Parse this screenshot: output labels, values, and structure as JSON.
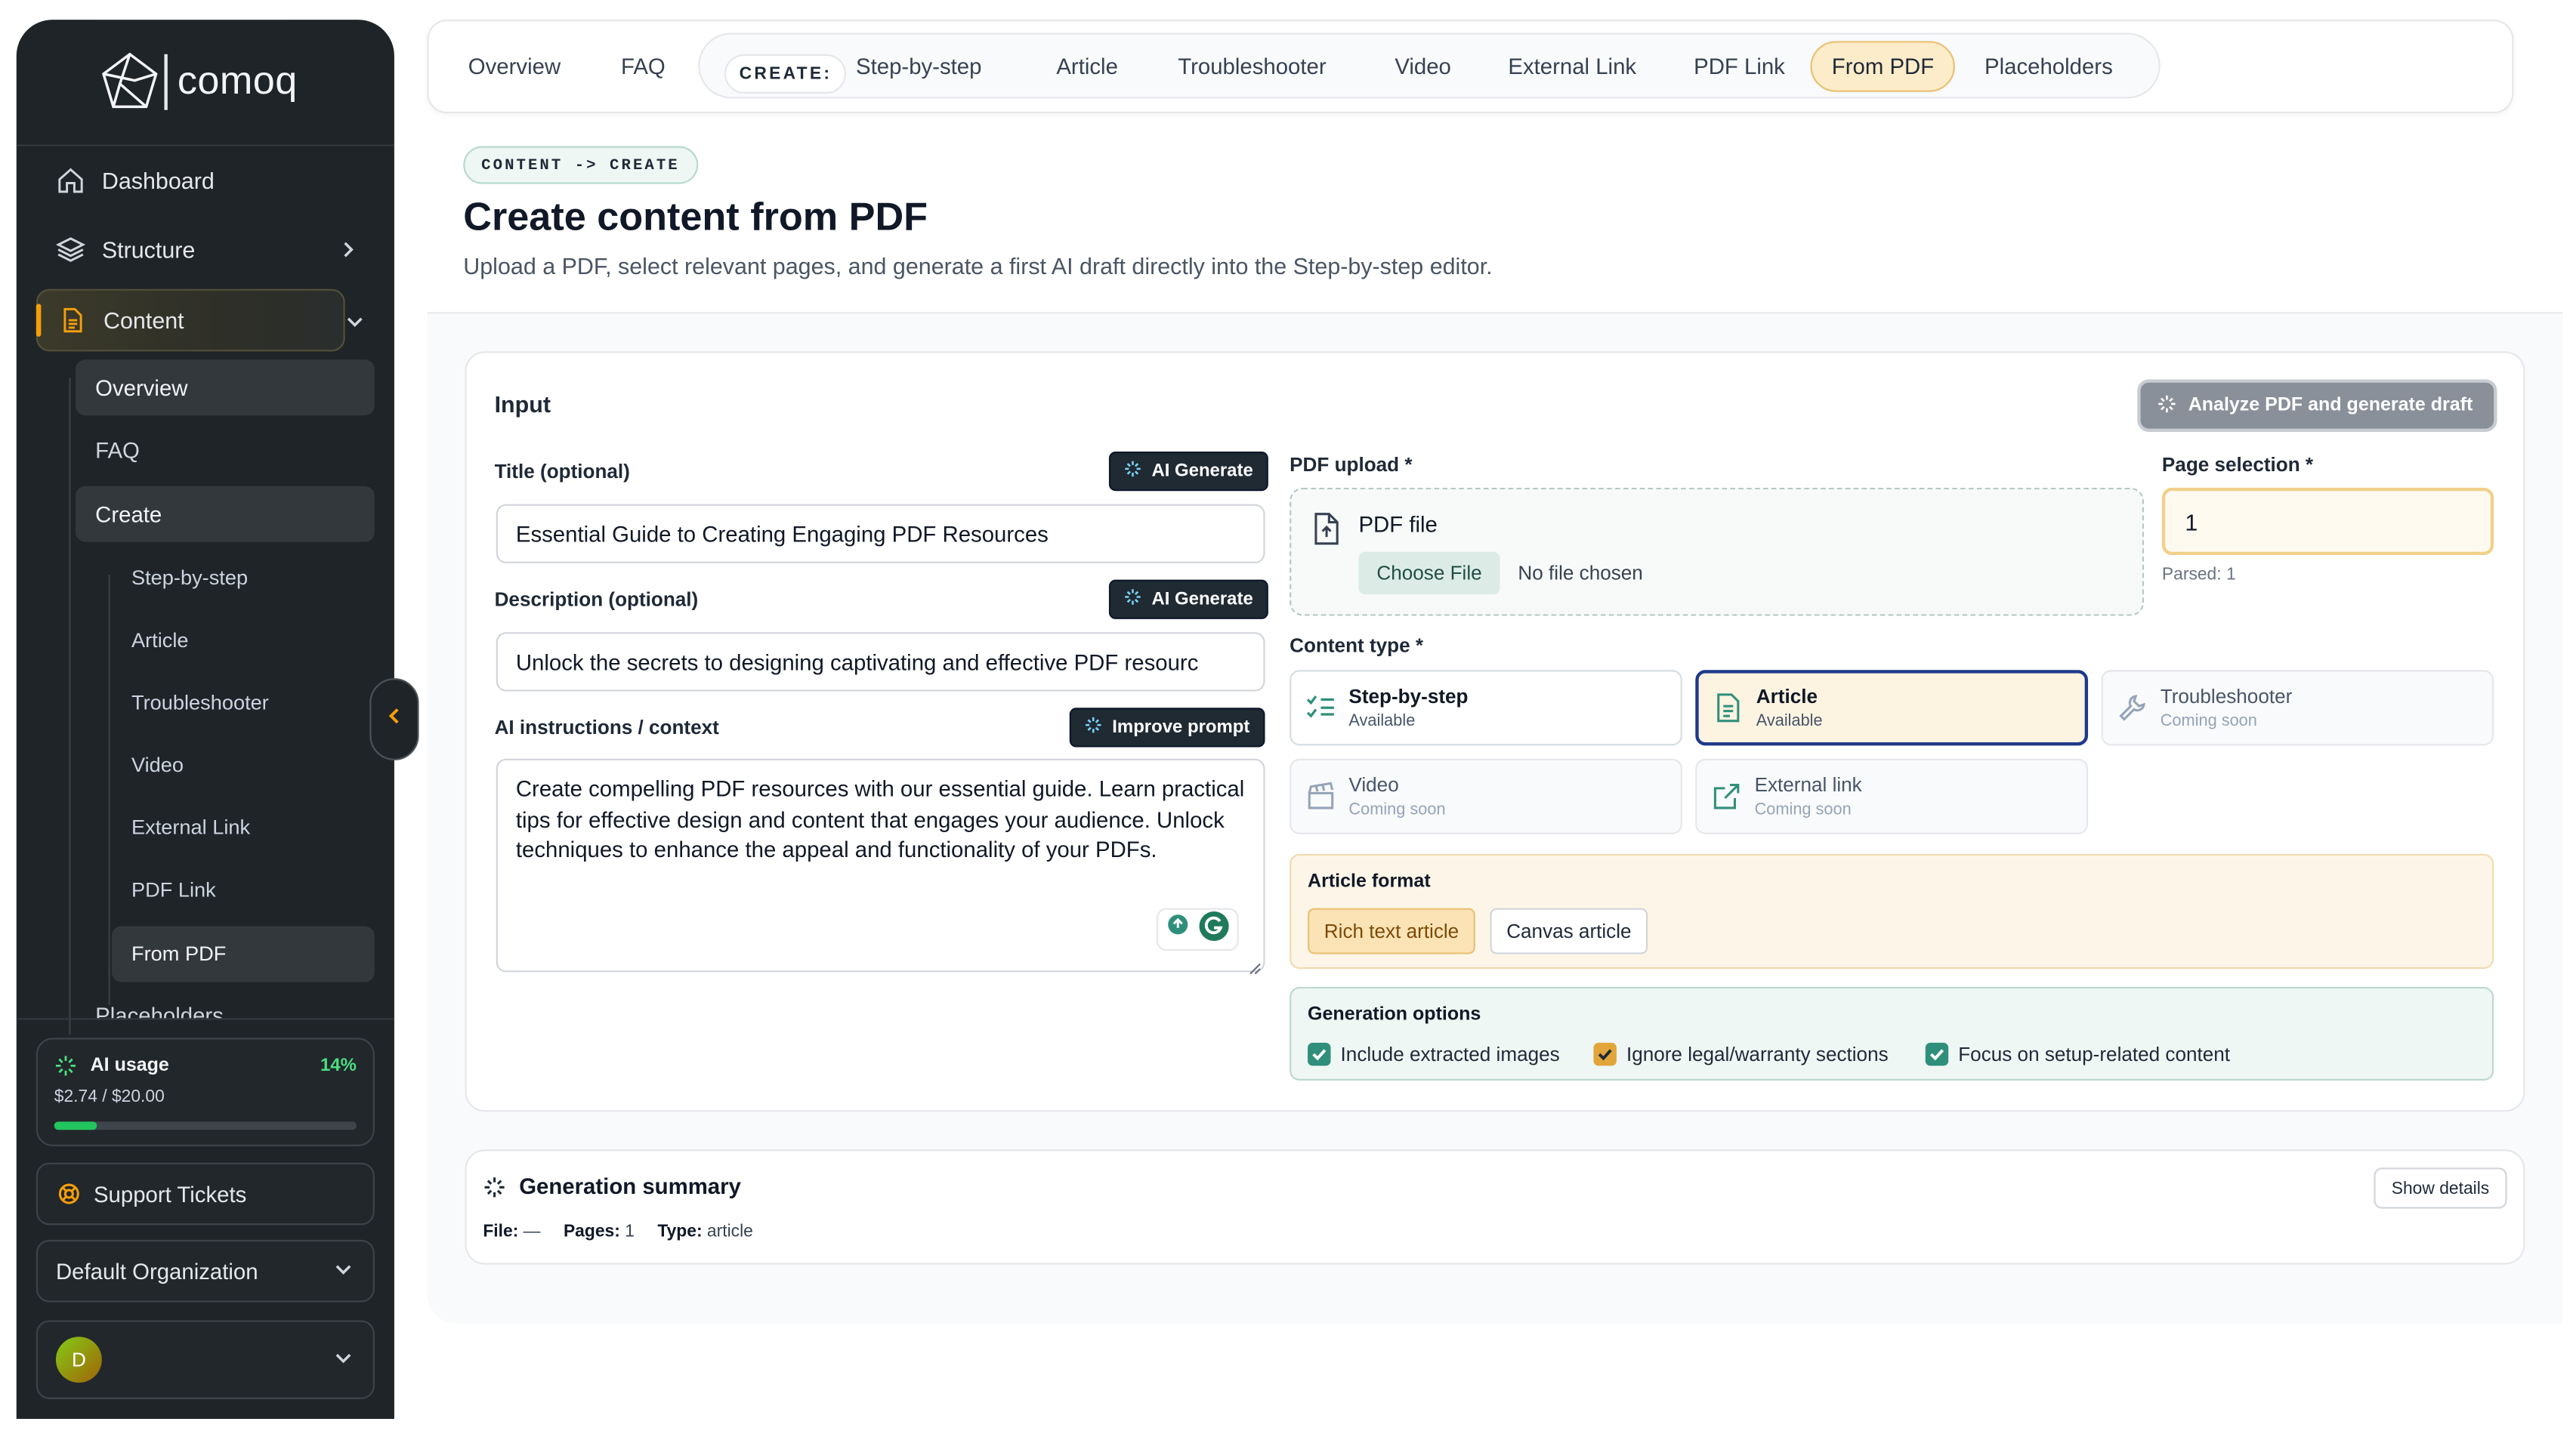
{
  "app": {
    "brand": "comoq"
  },
  "sidebar": {
    "nav": [
      {
        "label": "Dashboard",
        "icon": "home-icon"
      },
      {
        "label": "Structure",
        "icon": "layers-icon"
      },
      {
        "label": "Content",
        "icon": "document-icon"
      }
    ],
    "content_sub": [
      {
        "label": "Overview"
      },
      {
        "label": "FAQ"
      },
      {
        "label": "Create"
      }
    ],
    "create_sub": [
      {
        "label": "Step-by-step"
      },
      {
        "label": "Article"
      },
      {
        "label": "Troubleshooter"
      },
      {
        "label": "Video"
      },
      {
        "label": "External Link"
      },
      {
        "label": "PDF Link"
      },
      {
        "label": "From PDF"
      }
    ],
    "placeholders_partial": "Placeholders",
    "ai_usage": {
      "title": "AI usage",
      "percent": "14%",
      "amount": "$2.74 / $20.00",
      "fill_fraction": 0.14
    },
    "support": "Support Tickets",
    "organization": "Default Organization",
    "avatar_initial": "D"
  },
  "topbar": {
    "tabs": [
      "Overview",
      "FAQ"
    ],
    "create_label": "CREATE:",
    "create_tabs": [
      "Step-by-step",
      "Article",
      "Troubleshooter",
      "Video",
      "External Link",
      "PDF Link",
      "From PDF",
      "Placeholders"
    ],
    "active": "From PDF"
  },
  "header": {
    "breadcrumb": "CONTENT -> CREATE",
    "title": "Create content from PDF",
    "subtitle": "Upload a PDF, select relevant pages, and generate a first AI draft directly into the Step-by-step editor."
  },
  "input_card": {
    "heading": "Input",
    "analyze_button": "Analyze PDF and generate draft",
    "title_label": "Title (optional)",
    "title_value": "Essential Guide to Creating Engaging PDF Resources",
    "description_label": "Description (optional)",
    "description_value": "Unlock the secrets to designing captivating and effective PDF resourc",
    "ai_generate": "AI Generate",
    "instructions_label": "AI instructions / context",
    "improve_prompt": "Improve prompt",
    "instructions_value": "Create compelling PDF resources with our essential guide. Learn practical tips for effective design and content that engages your audience. Unlock techniques to enhance the appeal and functionality of your PDFs.",
    "pdf_upload_label": "PDF upload *",
    "pdf_file": "PDF file",
    "choose_file": "Choose File",
    "no_file": "No file chosen",
    "page_selection_label": "Page selection *",
    "page_selection_value": "1",
    "parsed": "Parsed: 1",
    "content_type_label": "Content type *",
    "content_types": [
      {
        "name": "Step-by-step",
        "status": "Available"
      },
      {
        "name": "Article",
        "status": "Available"
      },
      {
        "name": "Troubleshooter",
        "status": "Coming soon"
      },
      {
        "name": "Video",
        "status": "Coming soon"
      },
      {
        "name": "External link",
        "status": "Coming soon"
      }
    ],
    "selected_type": "Article",
    "article_format_label": "Article format",
    "formats": [
      "Rich text article",
      "Canvas article"
    ],
    "selected_format": "Rich text article",
    "generation_options_label": "Generation options",
    "options": [
      {
        "label": "Include extracted images",
        "checked": true,
        "color": "#2f8f7a"
      },
      {
        "label": "Ignore legal/warranty sections",
        "checked": true,
        "color": "#e2a53a"
      },
      {
        "label": "Focus on setup-related content",
        "checked": true,
        "color": "#2f8f7a"
      }
    ]
  },
  "summary": {
    "title": "Generation summary",
    "show_details": "Show details",
    "file_label": "File:",
    "file_value": "—",
    "pages_label": "Pages:",
    "pages_value": "1",
    "type_label": "Type:",
    "type_value": "article"
  },
  "colors": {
    "accent_amber": "#f59e0b",
    "teal": "#2f8f7a",
    "sidebar_bg": "#1f2428",
    "selected_border": "#1e3a8a"
  }
}
